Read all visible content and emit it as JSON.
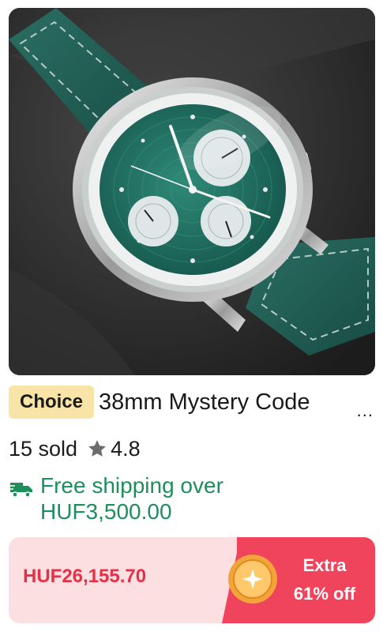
{
  "product": {
    "image_icon": "watch-product-image",
    "badge": "Choice",
    "title": "38mm Mystery Code",
    "more": "...",
    "sold": "15 sold",
    "rating": "4.8",
    "shipping_line1": "Free shipping over",
    "shipping_line2": "HUF3,500.00",
    "price": "HUF26,155.70",
    "promo_line1": "Extra",
    "promo_line2": "61% off"
  },
  "colors": {
    "badge_bg": "#f8e4a6",
    "shipping_green": "#1d8f5c",
    "price_red": "#e53048",
    "promo_bg": "#f0445d",
    "price_bar_bg": "#fbdfe1"
  }
}
